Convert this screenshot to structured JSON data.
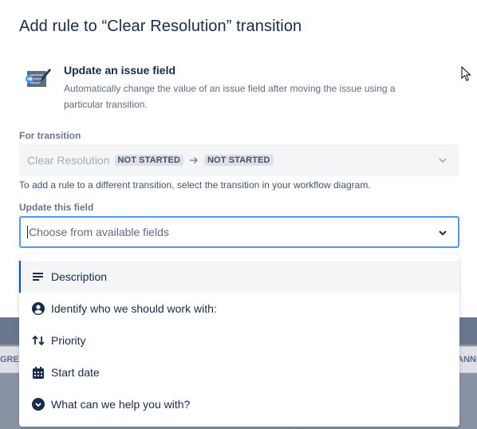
{
  "modal": {
    "title": "Add rule to “Clear Resolution” transition",
    "rule": {
      "name": "Update an issue field",
      "description": "Automatically change the value of an issue field after moving the issue using a particular transition.",
      "icon": "update-field-icon"
    },
    "for_transition": {
      "label": "For transition",
      "transition_name": "Clear Resolution",
      "from_status": "NOT STARTED",
      "to_status": "NOT STARTED",
      "helper": "To add a rule to a different transition, select the transition in your workflow diagram."
    },
    "update_field": {
      "label": "Update this field",
      "placeholder": "Choose from available fields"
    }
  },
  "menu": {
    "items": [
      {
        "label": "Description",
        "icon": "description-icon"
      },
      {
        "label": "Identify who we should work with:",
        "icon": "user-circle-icon"
      },
      {
        "label": "Priority",
        "icon": "priority-icon"
      },
      {
        "label": "Start date",
        "icon": "calendar-icon"
      },
      {
        "label": "What can we help you with?",
        "icon": "chevron-circle-icon"
      }
    ]
  },
  "background": {
    "left_button": "GRESS",
    "right_button": "ANNE"
  },
  "colors": {
    "accent": "#0052cc",
    "focus_border": "#4c9aff",
    "text_primary": "#172b4d",
    "text_subtle": "#5e6c84",
    "disabled_bg": "#f4f5f7",
    "lozenge_bg": "#dfe1e6"
  }
}
